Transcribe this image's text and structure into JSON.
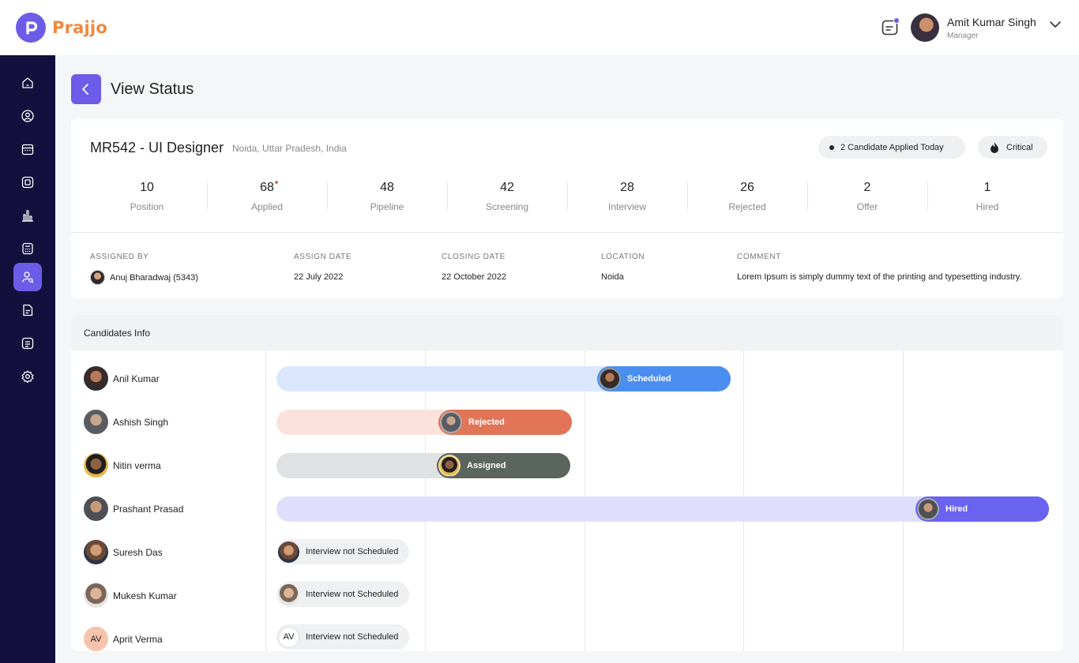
{
  "brand": {
    "name": "Prajjo",
    "accent": "#6c5ce7",
    "logo_color": "#f0883e"
  },
  "user": {
    "name": "Amit Kumar Singh",
    "role": "Manager"
  },
  "page": {
    "title": "View Status"
  },
  "job": {
    "title": "MR542 - UI Designer",
    "location": "Noida, Uttar Pradesh, India",
    "applied_today": "2 Candidate Applied Today",
    "priority": "Critical",
    "stats": [
      {
        "value": "10",
        "label": "Position"
      },
      {
        "value": "68",
        "label": "Applied",
        "new": true
      },
      {
        "value": "48",
        "label": "Pipeline"
      },
      {
        "value": "42",
        "label": "Screening"
      },
      {
        "value": "28",
        "label": "Interview"
      },
      {
        "value": "26",
        "label": "Rejected"
      },
      {
        "value": "2",
        "label": "Offer"
      },
      {
        "value": "1",
        "label": "Hired"
      }
    ],
    "meta": {
      "assigned_by_label": "ASSIGNED BY",
      "assigned_by": "Anuj Bharadwaj (5343)",
      "assign_date_label": "ASSIGN DATE",
      "assign_date": "22 July 2022",
      "closing_date_label": "CLOSING DATE",
      "closing_date": "22 October 2022",
      "location_label": "LOCATION",
      "location": "Noida",
      "comment_label": "COMMENT",
      "comment": "Lorem Ipsum is simply dummy text of the printing and typesetting industry."
    }
  },
  "candidates": {
    "heading": "Candidates Info",
    "rows": [
      {
        "name": "Anil Kumar",
        "status": "Scheduled",
        "color": "#4b8ef1",
        "track_color": "#dbe7fd"
      },
      {
        "name": "Ashish Singh",
        "status": "Rejected",
        "color": "#e27458",
        "track_color": "#fbe3dc"
      },
      {
        "name": "Nitin verma",
        "status": "Assigned",
        "color": "#5b645d",
        "track_color": "#dfe1e3"
      },
      {
        "name": "Prashant Prasad",
        "status": "Hired",
        "color": "#6a63ef",
        "track_color": "#e0dffb"
      },
      {
        "name": "Suresh Das",
        "status": "Interview not Scheduled"
      },
      {
        "name": "Mukesh Kumar",
        "status": "Interview not Scheduled"
      },
      {
        "name": "Aprit Verma",
        "initials": "AV",
        "status": "Interview not Scheduled"
      }
    ]
  },
  "icons": {
    "nav": [
      "home-icon",
      "user-icon",
      "calendar-icon",
      "news-icon",
      "chart-icon",
      "calculator-icon",
      "user-search-icon",
      "document-icon",
      "list-icon",
      "settings-icon"
    ]
  }
}
